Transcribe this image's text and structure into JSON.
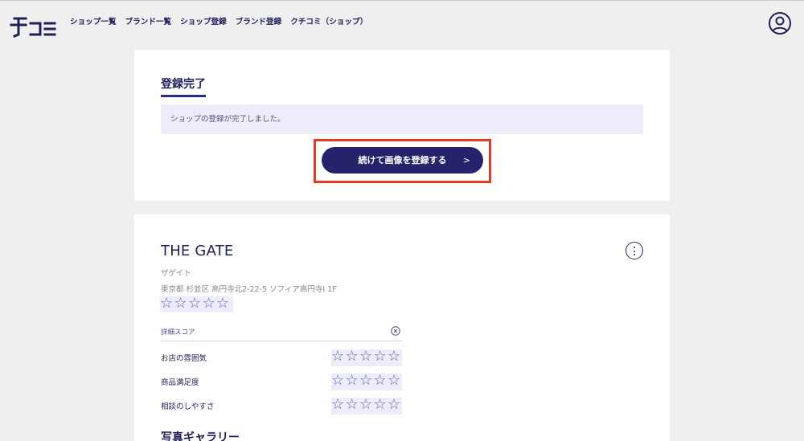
{
  "header": {
    "nav": [
      "ショップ一覧",
      "ブランド一覧",
      "ショップ登録",
      "ブランド登録",
      "クチコミ（ショップ）"
    ]
  },
  "complete": {
    "title": "登録完了",
    "notice": "ショップの登録が完了しました。",
    "cta_label": "続けて画像を登録する",
    "cta_chevron": ">"
  },
  "shop": {
    "name": "THE GATE",
    "kana": "ザゲイト",
    "address": "東京都 杉並区 高円寺北2-22-5 ソフィア高円寺Ⅰ 1F",
    "rating": 0,
    "detail_label": "詳細スコア",
    "scores": [
      {
        "label": "お店の雰囲気",
        "rating": 0
      },
      {
        "label": "商品満足度",
        "rating": 0
      },
      {
        "label": "相談のしやすさ",
        "rating": 0
      }
    ],
    "gallery_title": "写真ギャラリー"
  },
  "icons": {
    "logo": "fukomi-logo",
    "user": "user-icon",
    "more": "more-icon",
    "close": "close-icon",
    "star": "star-icon"
  },
  "colors": {
    "navy": "#1f1f5c",
    "cta": "#25246b",
    "highlight": "#e53a22",
    "notice_bg": "#ececfa"
  }
}
